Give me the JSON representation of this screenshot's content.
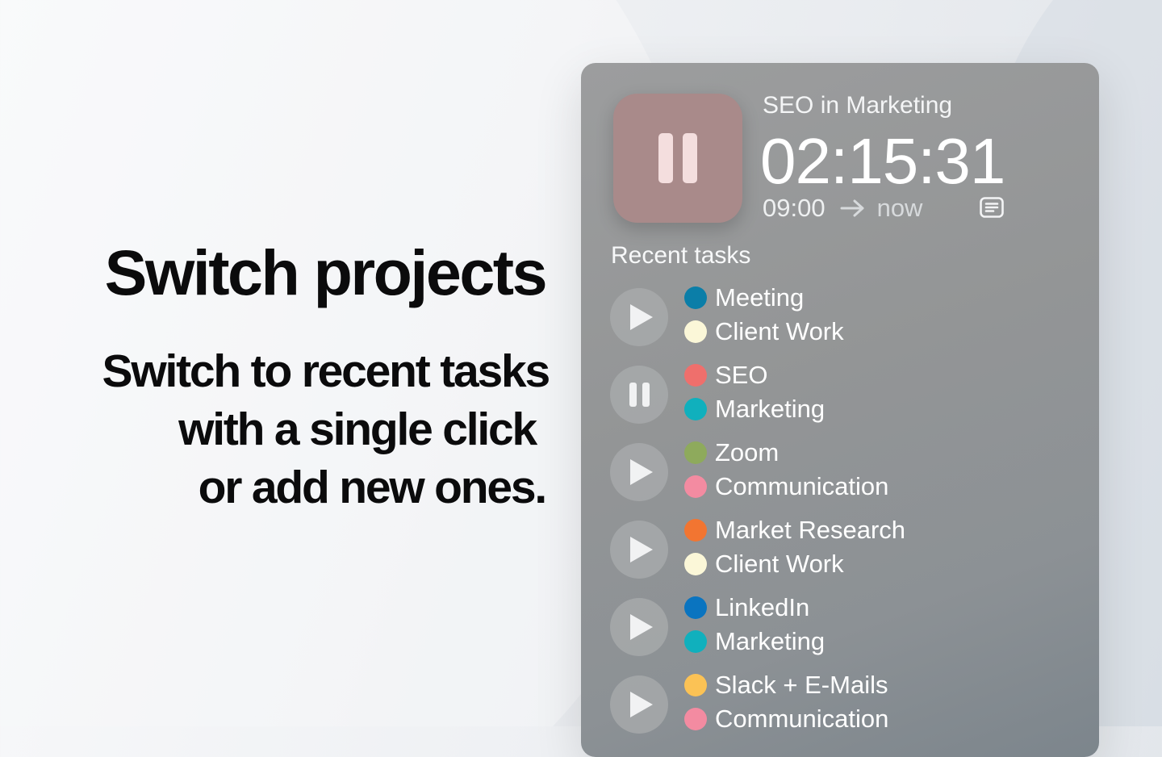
{
  "hero": {
    "title": "Switch projects",
    "subtitle_lines": [
      "Switch to recent tasks",
      "with a single click",
      "or add new ones."
    ]
  },
  "current": {
    "title": "SEO in Marketing",
    "timer": "02:15:31",
    "start": "09:00",
    "end": "now",
    "button_icon": "pause-icon",
    "button_color": "#a98a8a",
    "note_icon": "note-icon"
  },
  "recent": {
    "heading": "Recent tasks",
    "tasks": [
      {
        "state": "play",
        "task": "Meeting",
        "task_color": "#0b7ea8",
        "project": "Client Work",
        "project_color": "#fbf7d8"
      },
      {
        "state": "pause",
        "task": "SEO",
        "task_color": "#ef6f6c",
        "project": "Marketing",
        "project_color": "#10b0bd"
      },
      {
        "state": "play",
        "task": "Zoom",
        "task_color": "#8eaa5c",
        "project": "Communication",
        "project_color": "#f38ba1"
      },
      {
        "state": "play",
        "task": "Market Research",
        "task_color": "#f27531",
        "project": "Client Work",
        "project_color": "#fbf7d8"
      },
      {
        "state": "play",
        "task": "LinkedIn",
        "task_color": "#0a74c0",
        "project": "Marketing",
        "project_color": "#10b0bd"
      },
      {
        "state": "play",
        "task": "Slack + E-Mails",
        "task_color": "#fbc255",
        "project": "Communication",
        "project_color": "#f38ba1"
      }
    ]
  }
}
